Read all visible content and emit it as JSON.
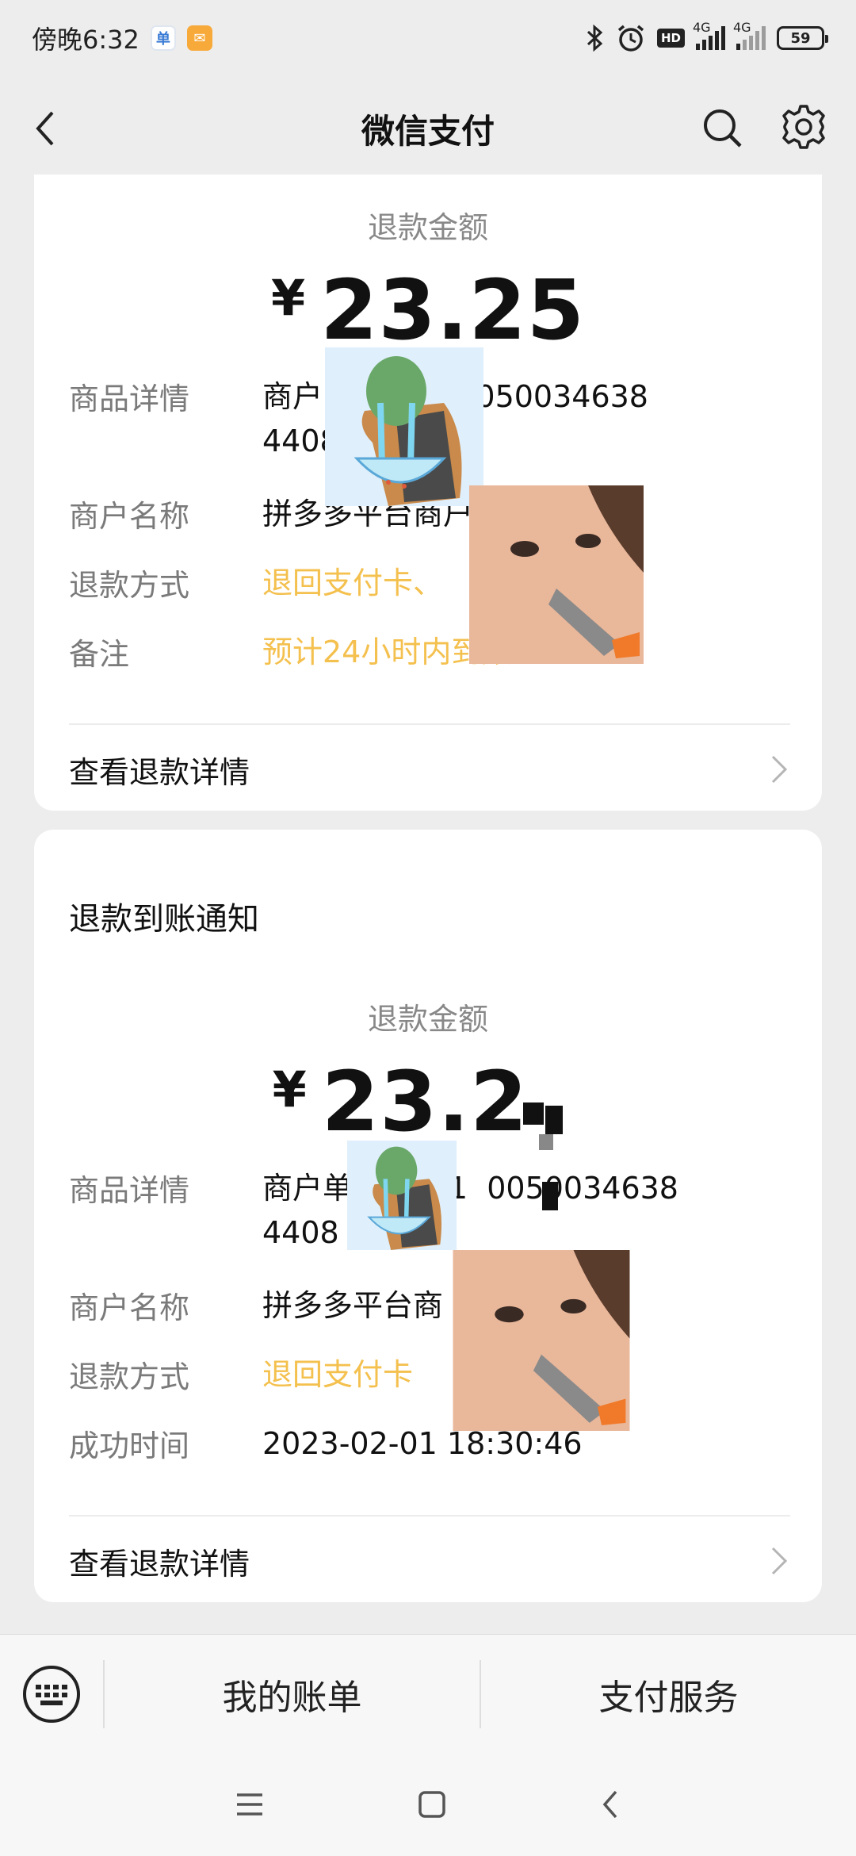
{
  "status_bar": {
    "time": "傍晚6:32",
    "network_1": "4G",
    "network_2": "4G",
    "hd": "HD",
    "battery": "59"
  },
  "nav": {
    "title": "微信支付"
  },
  "card1": {
    "amount_label": "退款金额",
    "currency": "¥",
    "amount": "23.25",
    "rows": [
      {
        "label": "商品详情",
        "value_line1": "商户  2301250050034638",
        "value_line2": "4408"
      },
      {
        "label": "商户名称",
        "value": "拼多多平台商户"
      },
      {
        "label": "退款方式",
        "value": "退回支付卡、"
      },
      {
        "label": "备注",
        "value": "预计24小时内到账"
      }
    ],
    "detail_link": "查看退款详情"
  },
  "card2": {
    "heading": "退款到账通知",
    "amount_label": "退款金额",
    "currency": "¥",
    "amount": "23.2",
    "rows": [
      {
        "label": "商品详情",
        "value_line1": "商户单  42301  0050034638",
        "value_line2": "4408"
      },
      {
        "label": "商户名称",
        "value": "拼多多平台商"
      },
      {
        "label": "退款方式",
        "value": "退回支付卡"
      },
      {
        "label": "成功时间",
        "value": "2023-02-01 18:30:46"
      }
    ],
    "detail_link": "查看退款详情"
  },
  "bottom_bar": {
    "my_bill": "我的账单",
    "pay_service": "支付服务"
  },
  "colors": {
    "accent_orange": "#f4c04e",
    "background": "#ededed"
  }
}
